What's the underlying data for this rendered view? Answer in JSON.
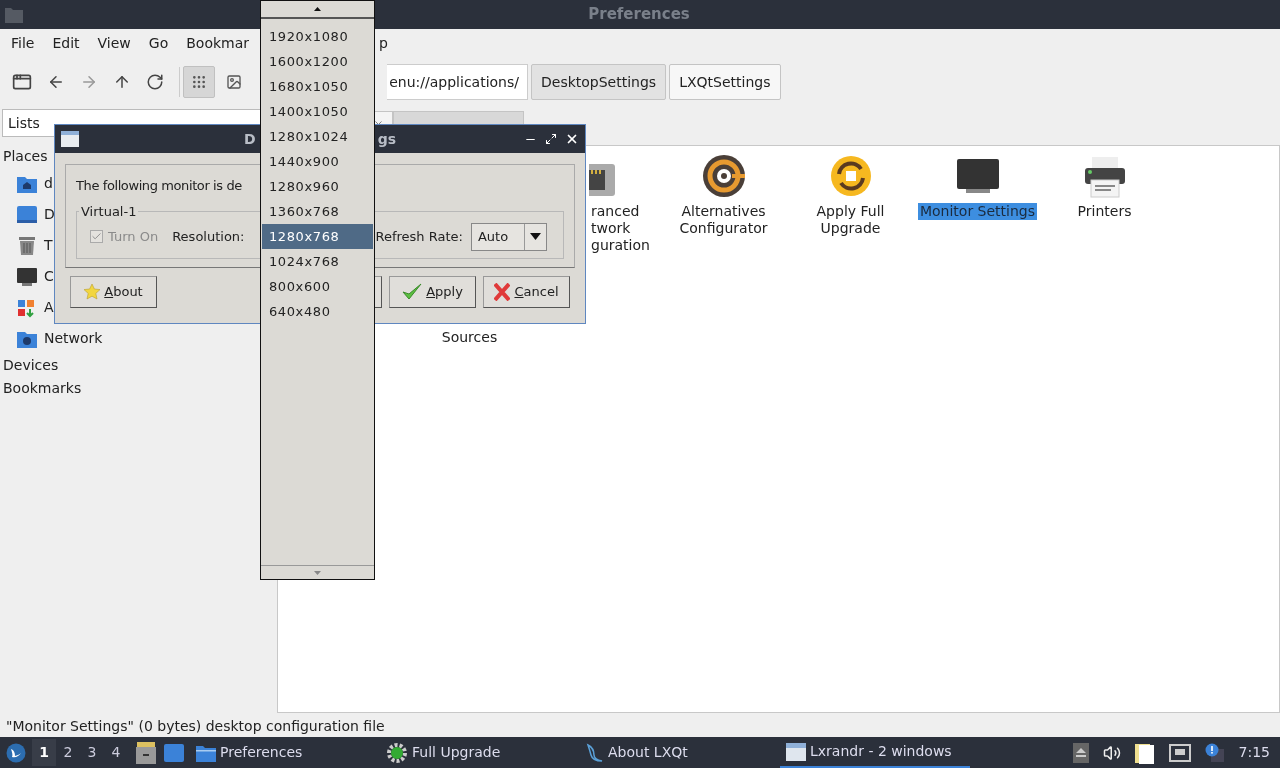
{
  "window": {
    "title": "Preferences"
  },
  "menu": [
    "File",
    "Edit",
    "View",
    "Go",
    "Bookmar",
    "p"
  ],
  "toolbar": {
    "path": "enu://applications/",
    "view_buttons": [
      {
        "kind": "icons",
        "selected": true
      },
      {
        "kind": "thumbnails",
        "selected": false
      }
    ],
    "breadcrumbs": [
      {
        "label": "DesktopSettings"
      },
      {
        "label": "LXQtSettings"
      }
    ]
  },
  "filter": {
    "value": "Lists"
  },
  "tabs": [
    {
      "selected": false
    },
    {
      "selected": true
    }
  ],
  "sidebar": {
    "sections": [
      {
        "title": "Places",
        "items": [
          {
            "kind": "home",
            "label": "d"
          },
          {
            "kind": "desktop",
            "label": "D"
          },
          {
            "kind": "trash",
            "label": "T"
          },
          {
            "kind": "computer",
            "label": "C"
          },
          {
            "kind": "apps",
            "label": "A"
          },
          {
            "kind": "network",
            "label": "Network"
          }
        ]
      },
      {
        "title": "Devices"
      },
      {
        "title": "Bookmarks"
      }
    ]
  },
  "files": [
    [
      {
        "kind": "netcard",
        "label": "ranced\ntwork\nguration",
        "selected": false
      },
      {
        "kind": "alternatives",
        "label": "Alternatives\nConfigurator",
        "selected": false
      },
      {
        "kind": "upgrade",
        "label": "Apply Full\nUpgrade",
        "selected": false
      },
      {
        "kind": "monitor",
        "label": "Monitor Settings",
        "selected": true
      },
      {
        "kind": "printer",
        "label": "Printers",
        "selected": false
      }
    ],
    [
      {
        "kind": "hidden",
        "label": "Sources",
        "selected": false
      }
    ]
  ],
  "status_bar": "\"Monitor Settings\" (0 bytes) desktop configuration file",
  "dialog": {
    "title_left": "D",
    "title_right": "gs",
    "message": "The following monitor is de",
    "group": "Virtual-1",
    "turn_on": {
      "label": "Turn On",
      "checked": true,
      "disabled": true
    },
    "resolution_label": "Resolution:",
    "refresh_label": "Refresh Rate:",
    "refresh_value": "Auto",
    "buttons": [
      {
        "kind": "about",
        "label": "About"
      },
      {
        "kind": "edge"
      },
      {
        "kind": "apply",
        "label": "Apply"
      },
      {
        "kind": "cancel",
        "label": "Cancel"
      }
    ]
  },
  "resolution_menu": [
    {
      "label": "1920x1080",
      "selected": false
    },
    {
      "label": "1600x1200",
      "selected": false
    },
    {
      "label": "1680x1050",
      "selected": false
    },
    {
      "label": "1400x1050",
      "selected": false
    },
    {
      "label": "1280x1024",
      "selected": false
    },
    {
      "label": "1440x900",
      "selected": false
    },
    {
      "label": "1280x960",
      "selected": false
    },
    {
      "label": "1360x768",
      "selected": false
    },
    {
      "label": "1280x768",
      "selected": true
    },
    {
      "label": "1024x768",
      "selected": false
    },
    {
      "label": "800x600",
      "selected": false
    },
    {
      "label": "640x480",
      "selected": false
    }
  ],
  "taskbar": {
    "desktops": [
      {
        "label": "1",
        "selected": true
      },
      {
        "label": "2",
        "selected": false
      },
      {
        "label": "3",
        "selected": false
      },
      {
        "label": "4",
        "selected": false
      }
    ],
    "tasks": [
      {
        "kind": "folder",
        "label": "Preferences",
        "selected": false
      },
      {
        "kind": "gear",
        "label": "Full Upgrade",
        "selected": false
      },
      {
        "kind": "bird",
        "label": "About LXQt",
        "selected": false
      },
      {
        "kind": "window",
        "label": "Lxrandr - 2 windows",
        "selected": true
      }
    ],
    "clock": "7:15"
  }
}
